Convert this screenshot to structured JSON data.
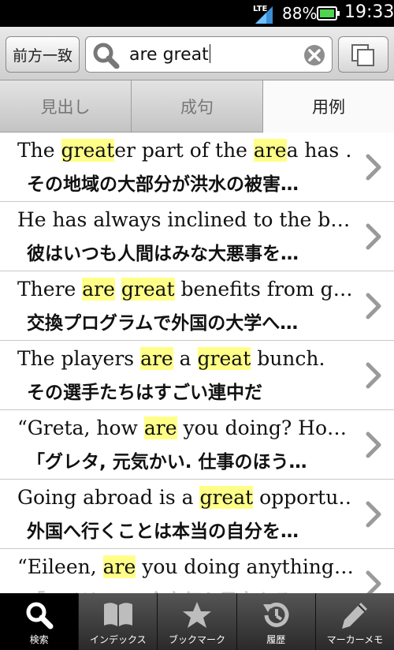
{
  "status": {
    "network": "LTE",
    "battery_percent": "88%",
    "time": "19:33"
  },
  "toolbar": {
    "mode_label": "前方一致",
    "search_value": "are great",
    "search_icon": "search-icon",
    "clear_icon": "clear-icon",
    "copy_icon": "copy-icon"
  },
  "tabs": [
    {
      "label": "見出し",
      "active": false
    },
    {
      "label": "成句",
      "active": false
    },
    {
      "label": "用例",
      "active": true
    }
  ],
  "highlight_color": "#ffff88",
  "results": [
    {
      "en_segments": [
        {
          "t": "The "
        },
        {
          "t": "great",
          "hl": true
        },
        {
          "t": "er part of the "
        },
        {
          "t": "are",
          "hl": true
        },
        {
          "t": "a has …"
        }
      ],
      "ja": "その地域の大部分が洪水の被害…"
    },
    {
      "en_segments": [
        {
          "t": "He has always inclined to the b…"
        }
      ],
      "ja": "彼はいつも人間はみな大悪事を…"
    },
    {
      "en_segments": [
        {
          "t": "There "
        },
        {
          "t": "are",
          "hl": true
        },
        {
          "t": " "
        },
        {
          "t": "great",
          "hl": true
        },
        {
          "t": " benefits from g…"
        }
      ],
      "ja": "交換プログラムで外国の大学へ…"
    },
    {
      "en_segments": [
        {
          "t": "The players "
        },
        {
          "t": "are",
          "hl": true
        },
        {
          "t": " a "
        },
        {
          "t": "great",
          "hl": true
        },
        {
          "t": " bunch."
        }
      ],
      "ja": "その選手たちはすごい連中だ"
    },
    {
      "en_segments": [
        {
          "t": "“Greta, how "
        },
        {
          "t": "are",
          "hl": true
        },
        {
          "t": " you doing? Ho…"
        }
      ],
      "ja": "「グレタ, 元気かい. 仕事のほう…"
    },
    {
      "en_segments": [
        {
          "t": "Going abroad is a "
        },
        {
          "t": "great",
          "hl": true
        },
        {
          "t": " opportu…"
        }
      ],
      "ja": "外国へ行くことは本当の自分を…"
    },
    {
      "en_segments": [
        {
          "t": "“Eileen, "
        },
        {
          "t": "are",
          "hl": true
        },
        {
          "t": " you doing anything…"
        }
      ],
      "ja": "「アイリーン, 今夜何か予定ある…",
      "partial": true
    }
  ],
  "bottom_nav": [
    {
      "label": "検索",
      "icon": "search-icon",
      "active": true
    },
    {
      "label": "インデックス",
      "icon": "book-icon",
      "active": false
    },
    {
      "label": "ブックマーク",
      "icon": "star-icon",
      "active": false
    },
    {
      "label": "履歴",
      "icon": "history-icon",
      "active": false
    },
    {
      "label": "マーカーメモ",
      "icon": "pen-icon",
      "active": false
    }
  ]
}
